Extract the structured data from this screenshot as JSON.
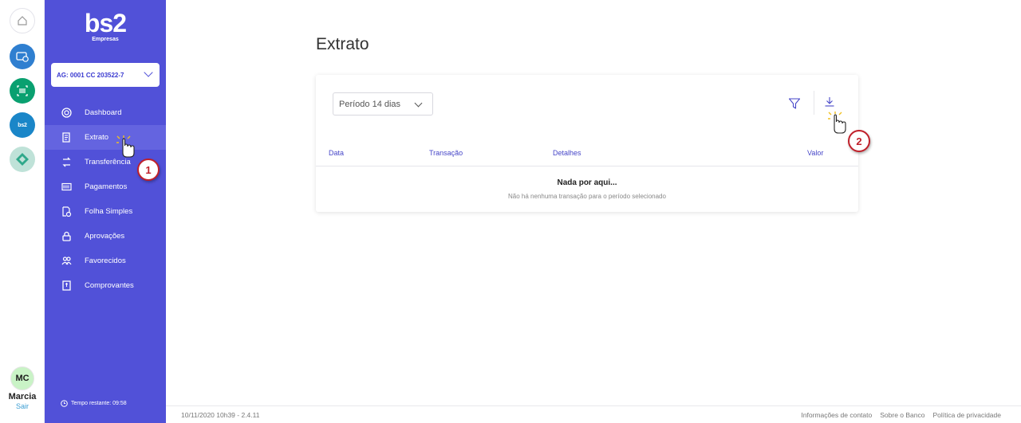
{
  "rail": {
    "bs2_badge": "bs2",
    "user_initials": "MC",
    "user_name": "Marcia",
    "logout": "Sair"
  },
  "sidebar": {
    "logo": "bs2",
    "logo_sub": "Empresas",
    "account": "AG: 0001 CC 203522-7",
    "items": [
      {
        "label": "Dashboard",
        "icon": "dashboard-icon"
      },
      {
        "label": "Extrato",
        "icon": "statement-icon"
      },
      {
        "label": "Transferência",
        "icon": "transfer-icon"
      },
      {
        "label": "Pagamentos",
        "icon": "barcode-icon"
      },
      {
        "label": "Folha Simples",
        "icon": "payroll-icon"
      },
      {
        "label": "Aprovações",
        "icon": "lock-icon"
      },
      {
        "label": "Favorecidos",
        "icon": "contacts-icon"
      },
      {
        "label": "Comprovantes",
        "icon": "receipt-icon"
      }
    ],
    "active_item": "Extrato",
    "timer": "Tempo restante: 09:58"
  },
  "main": {
    "title": "Extrato",
    "period": "Período 14 dias",
    "columns": [
      "Data",
      "Transação",
      "Detalhes",
      "Valor"
    ],
    "empty_title": "Nada por aqui...",
    "empty_subtitle": "Não há nenhuma transação para o período selecionado"
  },
  "footer": {
    "left": "10/11/2020 10h39  -  2.4.11",
    "links": [
      "Informações de contato",
      "Sobre o Banco",
      "Política de privacidade"
    ]
  },
  "annotations": {
    "step1": "1",
    "step2": "2"
  },
  "colors": {
    "sidebar": "#5151d8",
    "accent": "#4646c8",
    "marker": "#c0202a"
  }
}
